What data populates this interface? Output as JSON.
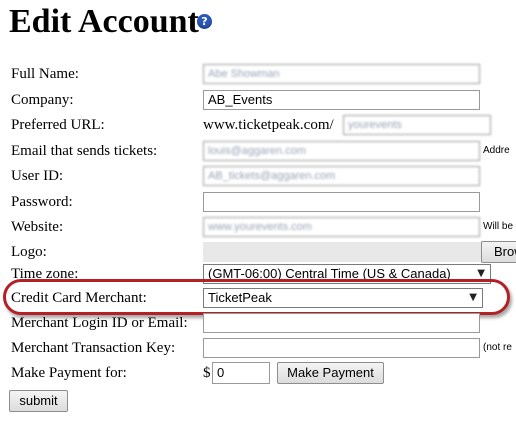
{
  "page": {
    "title": "Edit Account",
    "help_icon": "?"
  },
  "labels": {
    "full_name": "Full Name:",
    "company": "Company:",
    "preferred_url": "Preferred URL:",
    "email": "Email that sends tickets:",
    "user_id": "User ID:",
    "password": "Password:",
    "website": "Website:",
    "logo": "Logo:",
    "time_zone": "Time zone:",
    "cc_merchant": "Credit Card Merchant:",
    "merchant_login": "Merchant Login ID or Email:",
    "merchant_key": "Merchant Transaction Key:",
    "make_payment": "Make Payment for:"
  },
  "values": {
    "full_name": "Abe Showman",
    "company": "AB_Events",
    "url_prefix": "www.ticketpeak.com/",
    "url_slug": "yourevents",
    "email": "louis@aggaren.com",
    "user_id": "AB_tickets@aggaren.com",
    "password": "",
    "website": "www.yourevents.com",
    "time_zone": "(GMT-06:00) Central Time (US & Canada)",
    "cc_merchant": "TicketPeak",
    "merchant_login": "",
    "merchant_key": "",
    "currency": "$",
    "payment_amount": "0"
  },
  "side_notes": {
    "email": "Addre",
    "website": "Will be",
    "merchant_key": "(not re"
  },
  "buttons": {
    "browse": "Brow",
    "make_payment": "Make Payment",
    "submit": "submit"
  },
  "colors": {
    "highlight_ring": "#b32025",
    "help_icon": "#2a57b8"
  }
}
